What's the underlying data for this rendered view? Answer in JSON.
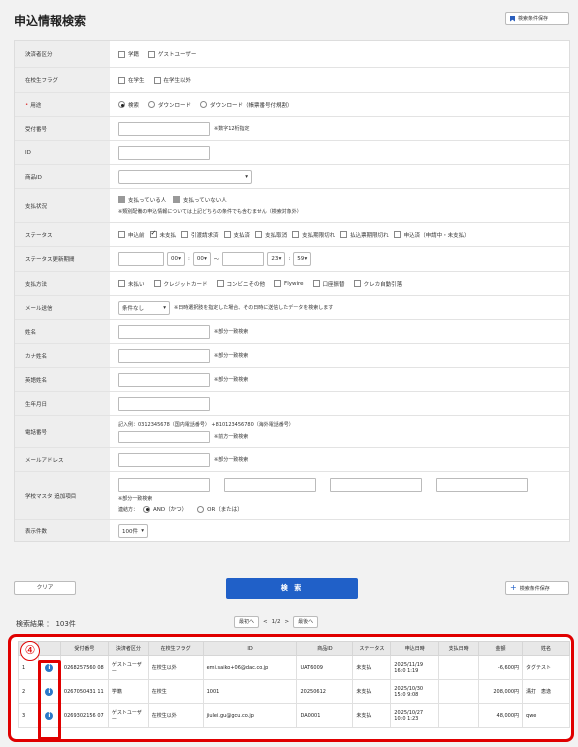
{
  "page": {
    "title": "申込情報検索",
    "save_conditions_top": "検索条件保存"
  },
  "form": {
    "applicant_type": {
      "label": "決済者区分",
      "options": [
        "学籍",
        "ゲストユーザー"
      ]
    },
    "enrollment_flag": {
      "label": "在校生フラグ",
      "options": [
        "在学生",
        "在学生以外"
      ]
    },
    "purpose": {
      "label": "用途",
      "options": [
        "検索",
        "ダウンロード",
        "ダウンロード（帳票番号付規割）"
      ]
    },
    "receipt_no": {
      "label": "受付番号",
      "note": "※数字12桁指定"
    },
    "id_field": {
      "label": "ID"
    },
    "item_id": {
      "label": "商品ID"
    },
    "payment_status": {
      "label": "支払状況",
      "options": [
        "支払っている人",
        "支払っていない人"
      ],
      "note": "※類別配備の申込情報については上記どちらの条件でも含むません（検索対象外）"
    },
    "status": {
      "label": "ステータス",
      "options": [
        "申込前",
        "未支払",
        "引渡請求済",
        "支払済",
        "支払取消",
        "支払期限切れ",
        "払込票期限切れ",
        "申込済（申請中・未支払）"
      ]
    },
    "status_date": {
      "label": "ステータス更新期間",
      "from_hour": "00",
      "from_min": "00",
      "tilde": "～",
      "to_hour": "23",
      "to_min": "59"
    },
    "payment_method": {
      "label": "支払方法",
      "options": [
        "未払い",
        "クレジットカード",
        "コンビニその他",
        "Flywire",
        "口座振替",
        "クレカ自動引落"
      ]
    },
    "mail_sent": {
      "label": "メール送信",
      "select_value": "条件なし",
      "note": "※日時選択肢を指定した場合、その日時に送信したデータを検索します"
    },
    "name": {
      "label": "姓名",
      "note": "※部分一致検索"
    },
    "kana_name": {
      "label": "カナ姓名",
      "note": "※部分一致検索"
    },
    "roman_name": {
      "label": "英語姓名",
      "note": "※部分一致検索"
    },
    "birthday": {
      "label": "生年月日"
    },
    "phone": {
      "label": "電話番号",
      "example": "記入例：0312345678（国内電話番号） +810123456780（海外電話番号）",
      "note": "※前方一致検索"
    },
    "email": {
      "label": "メールアドレス",
      "note": "※部分一致検索"
    },
    "extra_items": {
      "label": "学校マスタ 追加項目",
      "note": "※部分一致検索",
      "connector_label": "連結方：",
      "and_label": "AND（かつ）",
      "or_label": "OR（または）"
    },
    "display_count": {
      "label": "表示件数",
      "value": "100件"
    }
  },
  "actions": {
    "clear": "クリア",
    "search": "検 索",
    "save_conditions": "検索条件保存"
  },
  "results": {
    "count_label": "検索結果 ： 103件",
    "pager": {
      "first": "最初へ",
      "prev": "<",
      "page": "1/2",
      "next": ">",
      "last": "最後へ"
    },
    "annotation_number": "④",
    "columns": [
      "",
      "",
      "受付番号",
      "決済者区分",
      "在校生フラグ",
      "ID",
      "商品ID",
      "ステータス",
      "申込日時",
      "支払日時",
      "金額",
      "姓名"
    ],
    "rows": [
      {
        "no": "1",
        "receipt": "0268257560 08",
        "type": "ゲストユーザー",
        "flag": "在校生以外",
        "id": "emi.saiko+06@dac.co.jp",
        "item": "UAT6009",
        "status": "未支払",
        "applied": "2025/11/19 16:0 1:19",
        "paid": "",
        "amount": "-6,600円",
        "name": "タグテスト"
      },
      {
        "no": "2",
        "receipt": "0267050431 11",
        "type": "学籍",
        "flag": "在校生",
        "id": "1001",
        "item": "20250612",
        "status": "未支払",
        "applied": "2025/10/30 15:0 9:08",
        "paid": "",
        "amount": "208,000円",
        "name": "溝打　恵逸"
      },
      {
        "no": "3",
        "receipt": "0269302156 07",
        "type": "ゲストユーザー",
        "flag": "在校生以外",
        "id": "jiulei.gu@gcu.co.jp",
        "item": "DA0001",
        "status": "未支払",
        "applied": "2025/10/27 10:0 1:23",
        "paid": "",
        "amount": "48,000円",
        "name": "qwe"
      }
    ]
  }
}
